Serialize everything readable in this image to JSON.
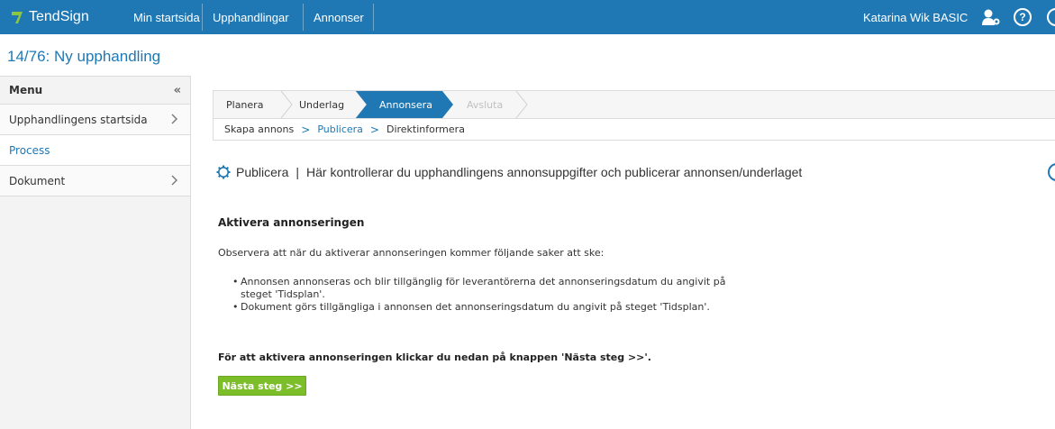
{
  "topbar": {
    "logo": "TendSign",
    "nav": [
      "Min startsida",
      "Upphandlingar",
      "Annonser"
    ],
    "user": "Katarina Wik BASIC",
    "help_glyph": "?",
    "colors": {
      "bar": "#1f78b4",
      "logo_mark": "#8dc63f"
    },
    "icons": [
      "user-settings-icon",
      "help-icon"
    ]
  },
  "page": {
    "title": "14/76: Ny upphandling"
  },
  "sidebar": {
    "header": "Menu",
    "collapse_glyph": "«",
    "items": [
      {
        "label": "Upphandlingens startsida",
        "has_chevron": true
      },
      {
        "label": "Process",
        "active": true,
        "has_chevron": false
      },
      {
        "label": "Dokument",
        "has_chevron": true
      }
    ]
  },
  "wizard": {
    "steps": [
      {
        "label": "Planera",
        "state": "done"
      },
      {
        "label": "Underlag",
        "state": "done"
      },
      {
        "label": "Annonsera",
        "state": "current"
      },
      {
        "label": "Avsluta",
        "state": "disabled"
      }
    ],
    "substeps": [
      {
        "label": "Skapa annons",
        "active": false
      },
      {
        "label": "Publicera",
        "active": true
      },
      {
        "label": "Direktinformera",
        "active": false
      }
    ],
    "separator": ">"
  },
  "main": {
    "section_title": "Publicera",
    "section_divider": "|",
    "section_desc": "Här kontrollerar du upphandlingens annonsuppgifter och publicerar annonsen/underlaget",
    "heading": "Aktivera annonseringen",
    "intro": "Observera att när du aktiverar annonseringen kommer följande saker att ske:",
    "bullets": [
      "Annonsen annonseras och blir tillgänglig för leverantörerna det annonseringsdatum du angivit på steget 'Tidsplan'.",
      "Dokument görs tillgängliga i annonsen det annonseringsdatum du angivit på steget 'Tidsplan'."
    ],
    "cta_text": "För att aktivera annonseringen klickar du nedan på knappen 'Nästa steg >>'.",
    "next_button": "Nästa steg >>",
    "colors": {
      "accent": "#1f78b4",
      "button": "#7cbd2a"
    }
  }
}
